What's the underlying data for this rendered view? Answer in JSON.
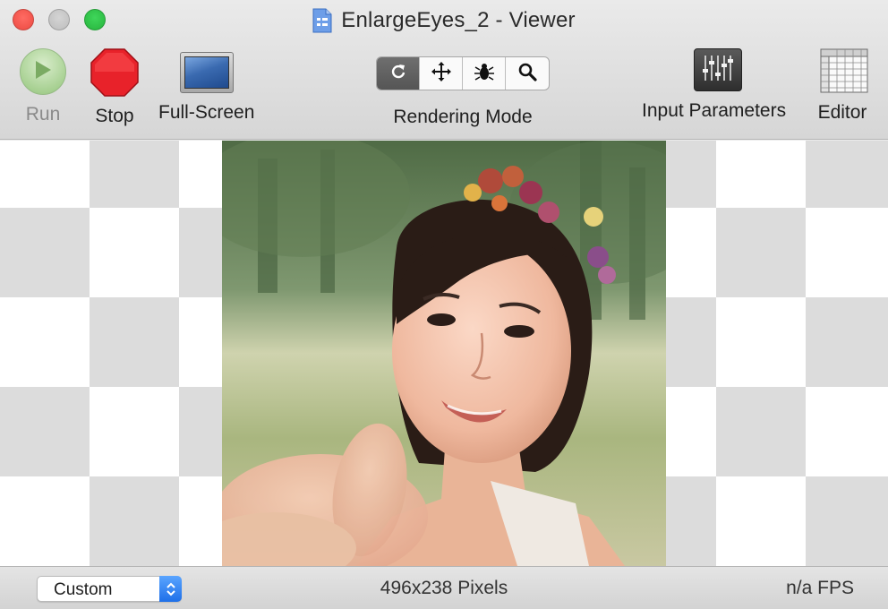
{
  "window": {
    "title": "EnlargeEyes_2 - Viewer"
  },
  "toolbar": {
    "run_label": "Run",
    "stop_label": "Stop",
    "fullscreen_label": "Full-Screen",
    "rendering_mode_label": "Rendering Mode",
    "rendering_mode_selected": "rotate",
    "rendering_mode_options": [
      "rotate-icon",
      "move-icon",
      "bug-icon",
      "magnifier-icon"
    ],
    "input_parameters_label": "Input Parameters",
    "editor_label": "Editor"
  },
  "statusbar": {
    "size_popup_value": "Custom",
    "dimensions": "496x238 Pixels",
    "fps": "n/a FPS"
  },
  "colors": {
    "stop_red": "#e8222a",
    "run_green": "#9fcf86",
    "stepper_blue": "#1e6fe8"
  }
}
